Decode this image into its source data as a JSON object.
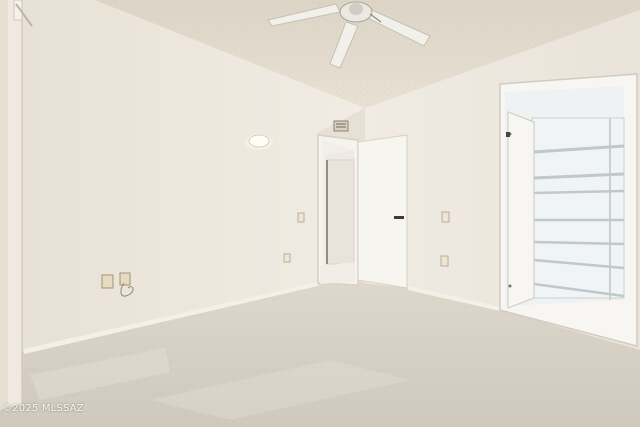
{
  "photo": {
    "watermark": "©2025 MLSSAZ",
    "colors": {
      "wall_left": "#ede7dc",
      "wall_right": "#eee9e0",
      "ceiling": "#e4ddcf",
      "carpet": "#dcd6cc",
      "door": "#f6f4ef",
      "shelf": "#eaeff0",
      "baseboard": "#f3efe7"
    }
  }
}
